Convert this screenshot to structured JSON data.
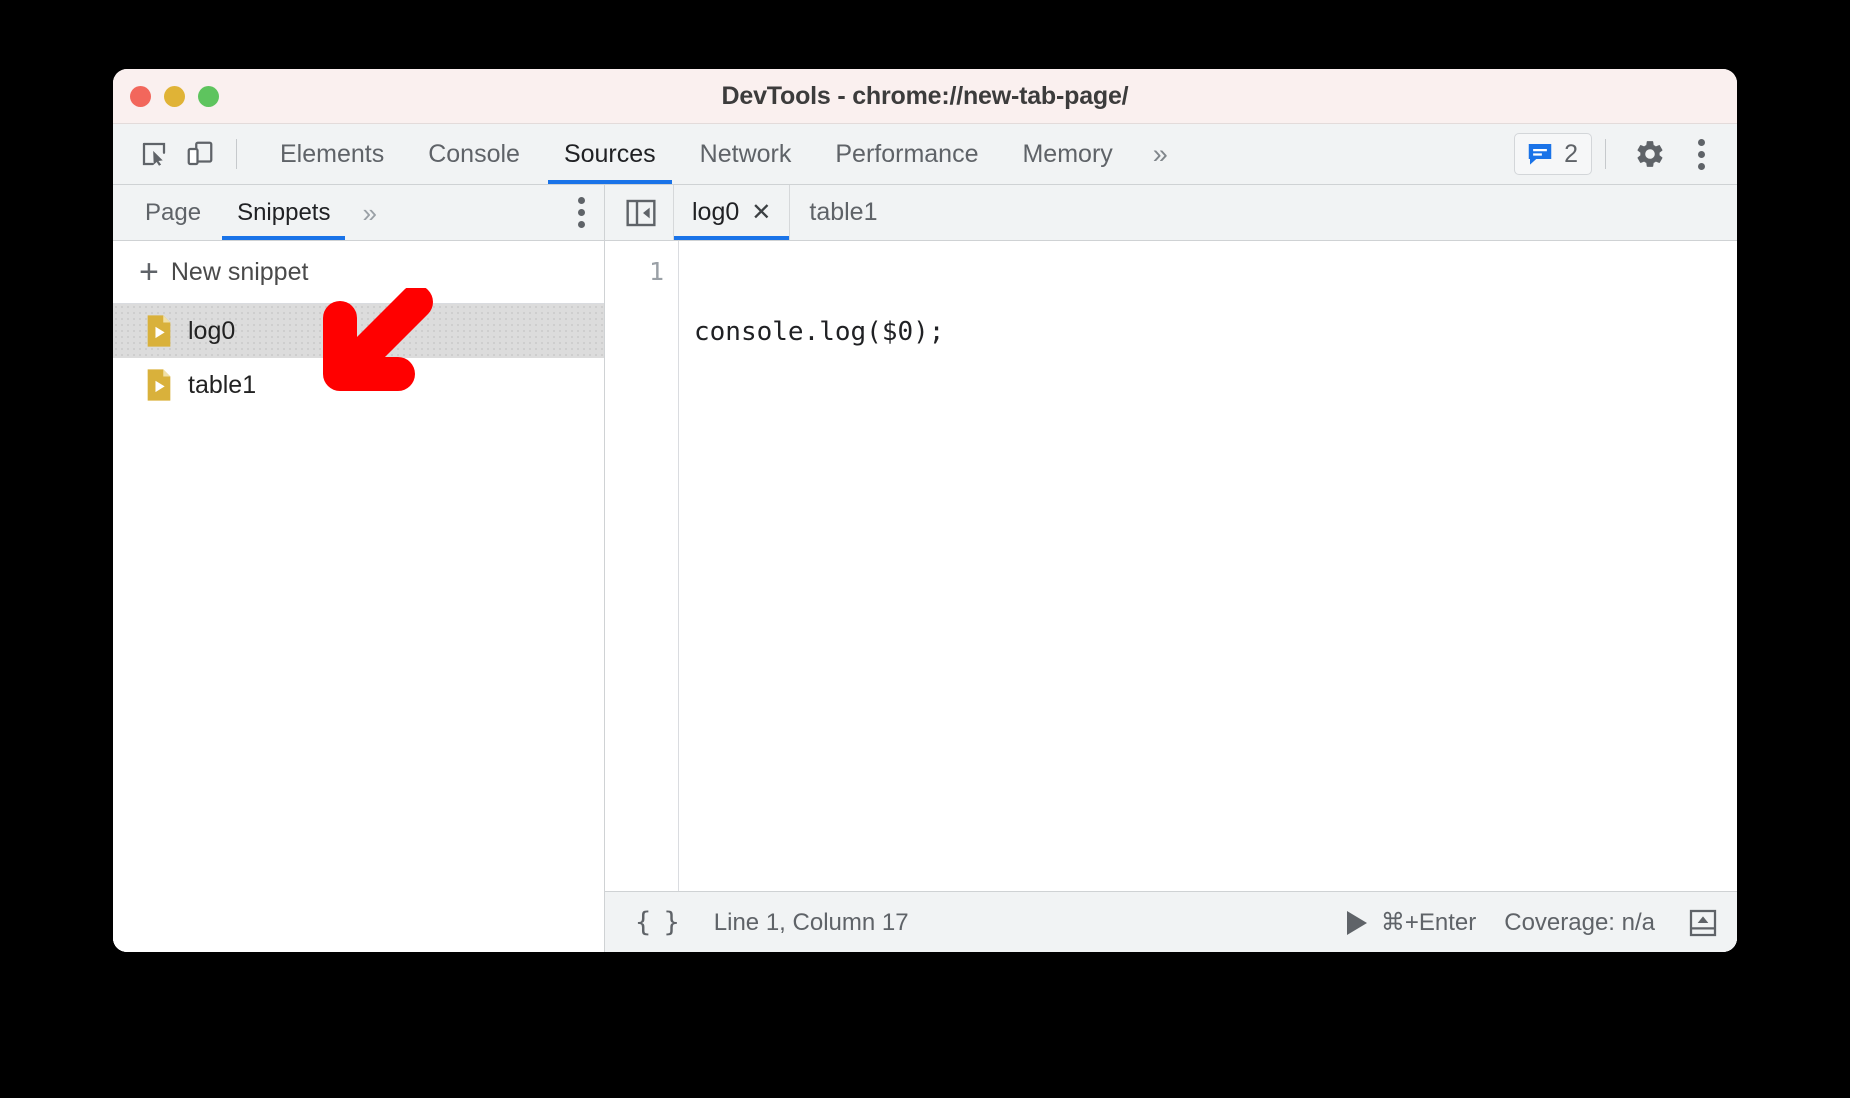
{
  "window": {
    "title": "DevTools - chrome://new-tab-page/",
    "traffic_lights": [
      "close-red",
      "minimize-yellow",
      "zoom-green"
    ],
    "titlebar_color": "#faf0ef"
  },
  "toolbar": {
    "inspect_icon": "inspect-cursor-icon",
    "device_icon": "device-toolbar-icon",
    "tabs": [
      {
        "label": "Elements",
        "active": false
      },
      {
        "label": "Console",
        "active": false
      },
      {
        "label": "Sources",
        "active": true
      },
      {
        "label": "Network",
        "active": false
      },
      {
        "label": "Performance",
        "active": false
      },
      {
        "label": "Memory",
        "active": false
      }
    ],
    "more_tabs_glyph": "»",
    "issues": {
      "icon": "issues-message-icon",
      "count": "2",
      "color": "#1a73e8"
    },
    "settings_icon": "gear-icon",
    "menu_icon": "kebab-menu-icon",
    "accent_color": "#1a73e8"
  },
  "navigator": {
    "tabs": [
      {
        "label": "Page",
        "active": false
      },
      {
        "label": "Snippets",
        "active": true
      }
    ],
    "more_tabs_glyph": "»",
    "menu_icon": "kebab-menu-icon",
    "new_snippet": {
      "plus": "+",
      "label": "New snippet"
    },
    "snippets": [
      {
        "label": "log0",
        "selected": true,
        "icon": "snippet-file-icon"
      },
      {
        "label": "table1",
        "selected": false,
        "icon": "snippet-file-icon"
      }
    ],
    "snippet_icon_color": "#d9b13b"
  },
  "editor": {
    "collapse_icon": "collapse-sidebar-icon",
    "tabs": [
      {
        "label": "log0",
        "active": true,
        "closable": true
      },
      {
        "label": "table1",
        "active": false,
        "closable": false
      }
    ],
    "close_glyph": "✕",
    "lines": [
      {
        "number": "1",
        "text": "console.log($0);"
      }
    ]
  },
  "statusbar": {
    "format_button": "{ }",
    "cursor_position": "Line 1, Column 17",
    "run_icon": "run-play-icon",
    "run_shortcut": "⌘+Enter",
    "coverage": "Coverage: n/a",
    "drawer_icon": "show-drawer-icon"
  },
  "annotation": {
    "arrow": "red-arrow-pointing-down-left",
    "color": "#ff0000"
  }
}
